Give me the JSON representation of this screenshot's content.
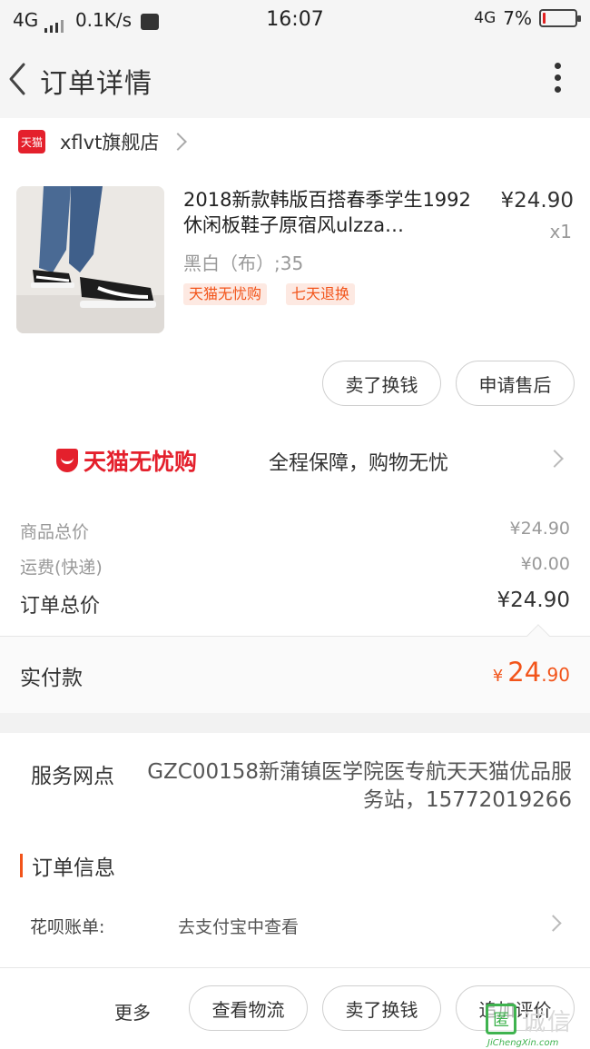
{
  "status_bar": {
    "network": "4G",
    "speed": "0.1K/s",
    "time": "16:07",
    "network_right": "4G",
    "battery_percent": "7%",
    "battery_level": 0.07
  },
  "nav": {
    "back_icon": "chevron-left-icon",
    "title": "订单详情",
    "more_icon": "more-vertical-icon"
  },
  "store": {
    "badge": "天猫",
    "name": "xflvt旗舰店"
  },
  "product": {
    "title": "2018新款韩版百搭春季学生1992休闲板鞋子原宿风ulzza…",
    "price": "¥24.90",
    "quantity": "x1",
    "sku": "黑白（布）;35",
    "tags": [
      "天猫无忧购",
      "七天退换"
    ],
    "actions": [
      "卖了换钱",
      "申请售后"
    ]
  },
  "guarantee": {
    "logo_text": "天猫无忧购",
    "slogan": "全程保障，购物无忧"
  },
  "summary": {
    "goods_label": "商品总价",
    "goods_value": "¥24.90",
    "shipping_label": "运费(快递)",
    "shipping_value": "¥0.00",
    "total_label": "订单总价",
    "total_value": "¥24.90"
  },
  "payment": {
    "label": "实付款",
    "currency": "¥",
    "integer": "24",
    "decimal": ".90"
  },
  "service": {
    "label": "服务网点",
    "text": "GZC00158新蒲镇医学院医专航天天猫优品服务站，15772019266"
  },
  "order_info": {
    "section_title": "订单信息",
    "huabei_label": "花呗账单:",
    "huabei_value": "去支付宝中查看"
  },
  "bottom_bar": {
    "more": "更多",
    "buttons": [
      "查看物流",
      "卖了换钱",
      "追加评价"
    ]
  },
  "watermark": {
    "badge": "匿",
    "text": "诚信",
    "url": "JiChengXin.com"
  },
  "colors": {
    "accent": "#f2541a",
    "tmall_red": "#e4202c"
  }
}
